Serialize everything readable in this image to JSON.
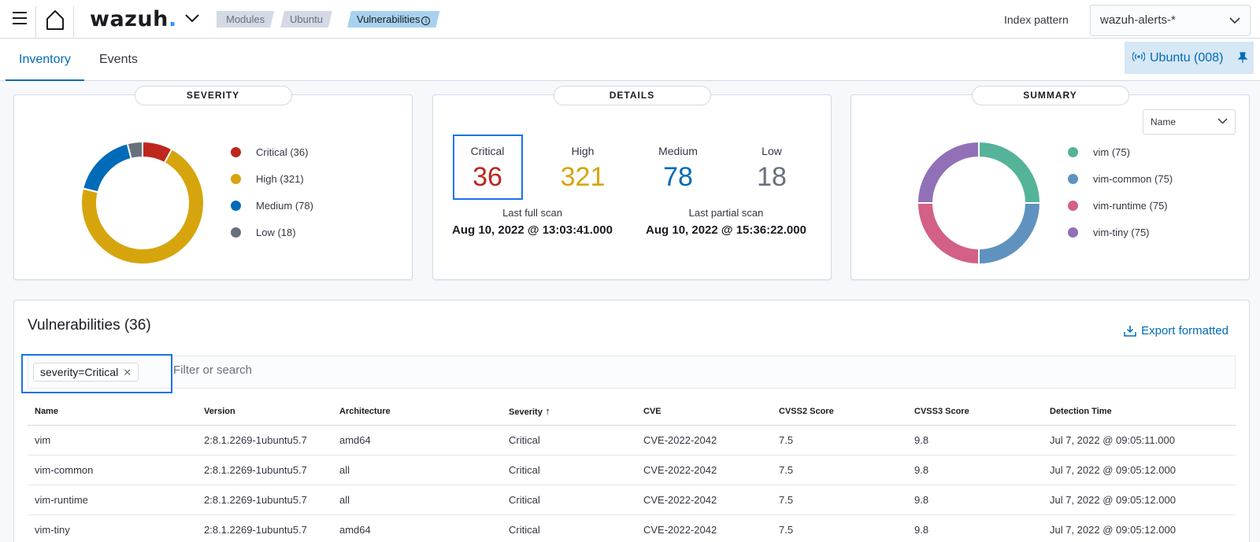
{
  "header": {
    "logo_text": "wazuh",
    "logo_dot": ".",
    "breadcrumbs": [
      "Modules",
      "Ubuntu",
      "Vulnerabilities"
    ],
    "index_label": "Index pattern",
    "index_value": "wazuh-alerts-*"
  },
  "tabs": [
    "Inventory",
    "Events"
  ],
  "agent": {
    "label": "Ubuntu (008)"
  },
  "severity_panel": {
    "title": "SEVERITY",
    "items": [
      {
        "label": "Critical (36)",
        "value": 36,
        "color": "#bd271e"
      },
      {
        "label": "High (321)",
        "value": 321,
        "color": "#d6a50e"
      },
      {
        "label": "Medium (78)",
        "value": 78,
        "color": "#006bb8"
      },
      {
        "label": "Low (18)",
        "value": 18,
        "color": "#69707d"
      }
    ]
  },
  "details_panel": {
    "title": "DETAILS",
    "counts": [
      {
        "label": "Critical",
        "value": "36",
        "color": "#bd271e"
      },
      {
        "label": "High",
        "value": "321",
        "color": "#d6a50e"
      },
      {
        "label": "Medium",
        "value": "78",
        "color": "#006bb8"
      },
      {
        "label": "Low",
        "value": "18",
        "color": "#69707d"
      }
    ],
    "last_full_scan_label": "Last full scan",
    "last_full_scan": "Aug 10, 2022 @ 13:03:41.000",
    "last_partial_scan_label": "Last partial scan",
    "last_partial_scan": "Aug 10, 2022 @ 15:36:22.000"
  },
  "summary_panel": {
    "title": "SUMMARY",
    "select_value": "Name",
    "items": [
      {
        "label": "vim (75)",
        "value": 75,
        "color": "#54b399"
      },
      {
        "label": "vim-common (75)",
        "value": 75,
        "color": "#6092c0"
      },
      {
        "label": "vim-runtime (75)",
        "value": 75,
        "color": "#d36086"
      },
      {
        "label": "vim-tiny (75)",
        "value": 75,
        "color": "#9170b8"
      }
    ]
  },
  "vulnerabilities": {
    "title": "Vulnerabilities (36)",
    "export_label": "Export formatted",
    "filter_pill": "severity=Critical",
    "search_placeholder": "Filter or search",
    "columns": [
      "Name",
      "Version",
      "Architecture",
      "Severity",
      "CVE",
      "CVSS2 Score",
      "CVSS3 Score",
      "Detection Time"
    ],
    "rows": [
      [
        "vim",
        "2:8.1.2269-1ubuntu5.7",
        "amd64",
        "Critical",
        "CVE-2022-2042",
        "7.5",
        "9.8",
        "Jul 7, 2022 @ 09:05:11.000"
      ],
      [
        "vim-common",
        "2:8.1.2269-1ubuntu5.7",
        "all",
        "Critical",
        "CVE-2022-2042",
        "7.5",
        "9.8",
        "Jul 7, 2022 @ 09:05:12.000"
      ],
      [
        "vim-runtime",
        "2:8.1.2269-1ubuntu5.7",
        "all",
        "Critical",
        "CVE-2022-2042",
        "7.5",
        "9.8",
        "Jul 7, 2022 @ 09:05:12.000"
      ],
      [
        "vim-tiny",
        "2:8.1.2269-1ubuntu5.7",
        "amd64",
        "Critical",
        "CVE-2022-2042",
        "7.5",
        "9.8",
        "Jul 7, 2022 @ 09:05:12.000"
      ]
    ]
  }
}
